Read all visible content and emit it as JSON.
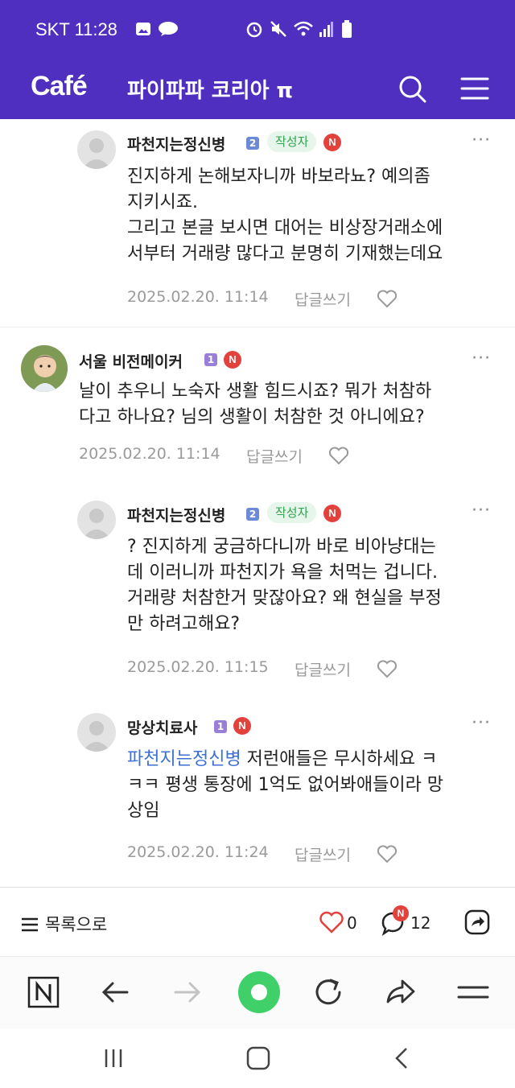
{
  "status_bar": {
    "carrier_time": "SKT 11:28"
  },
  "app_bar": {
    "logo": "Café",
    "cafe_name": "파이파파 코리아 π"
  },
  "comments": [
    {
      "author": "파천지는정신병",
      "level": "2",
      "writer_badge": "작성자",
      "new_badge": "N",
      "lines": [
        "진지하게 논해보자니까 바보라뇨? 예의좀",
        "지키시죠.",
        "그리고 본글 보시면 대어는 비상장거래소에",
        "서부터 거래량 많다고 분명히 기재했는데요"
      ],
      "timestamp": "2025.02.20. 11:14",
      "reply_label": "답글쓰기"
    },
    {
      "author": "서울 비전메이커",
      "level": "1",
      "new_badge": "N",
      "lines": [
        "날이 추우니 노숙자 생활 힘드시죠? 뭐가 처참하",
        "다고 하나요? 님의 생활이 처참한 것 아니에요?"
      ],
      "timestamp": "2025.02.20. 11:14",
      "reply_label": "답글쓰기"
    },
    {
      "author": "파천지는정신병",
      "level": "2",
      "writer_badge": "작성자",
      "new_badge": "N",
      "lines": [
        "? 진지하게 궁금하다니까 바로 비아냥대는",
        "데 이러니까 파천지가 욕을 처먹는 겁니다.",
        "거래량 처참한거 맞잖아요? 왜 현실을 부정",
        "만 하려고해요?"
      ],
      "timestamp": "2025.02.20. 11:15",
      "reply_label": "답글쓰기"
    },
    {
      "author": "망상치료사",
      "level": "1",
      "new_badge": "N",
      "mention": "파천지는정신병",
      "first_line_rest": " 저런애들은 무시하세요 ㅋ",
      "lines": [
        "ㅋㅋ 평생 통장에 1억도 없어봐애들이라 망",
        "상임"
      ],
      "timestamp": "2025.02.20. 11:24",
      "reply_label": "답글쓰기"
    }
  ],
  "action_bar": {
    "list_label": "목록으로",
    "like_count": "0",
    "comment_new_badge": "N",
    "comment_count": "12"
  },
  "colors": {
    "brand_purple": "#4f2fbf",
    "writer_badge_green": "#2fa44f",
    "new_badge_red": "#e3413c",
    "mention_blue": "#3b6fd6",
    "browser_green": "#3fd06a"
  }
}
